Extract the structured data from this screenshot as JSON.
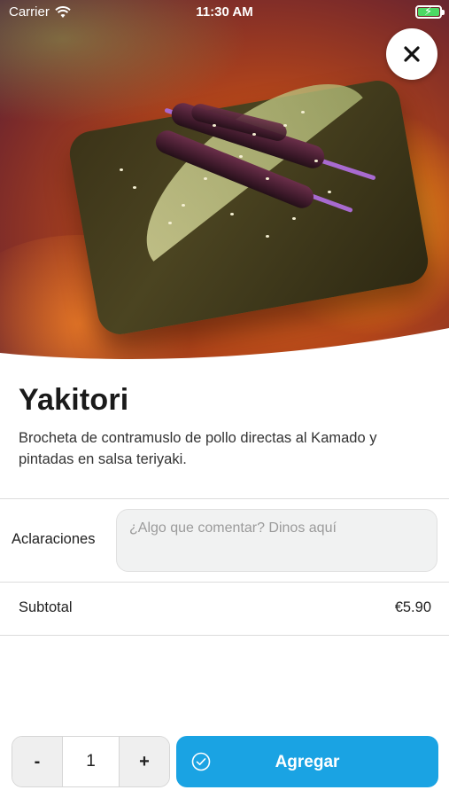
{
  "status_bar": {
    "carrier": "Carrier",
    "time": "11:30 AM",
    "battery_icon": "battery-charging-icon",
    "wifi_icon": "wifi-icon"
  },
  "hero": {
    "image_alt": "photo-of-yakitori-skewers"
  },
  "close_button": {
    "icon": "close-icon",
    "glyph": "✕"
  },
  "product": {
    "name": "Yakitori",
    "description": "Brocheta de contramuslo de pollo directas al Kamado y pintadas en salsa teriyaki."
  },
  "clarifications": {
    "label": "Aclaraciones",
    "placeholder": "¿Algo que comentar? Dinos aquí",
    "value": ""
  },
  "subtotal": {
    "label": "Subtotal",
    "value": "€5.90"
  },
  "quantity": {
    "decrement_label": "-",
    "value": "1",
    "increment_label": "+"
  },
  "add_button": {
    "label": "Agregar",
    "icon": "check-circle-icon"
  },
  "colors": {
    "accent": "#1aa3e3",
    "text": "#1a1a1a",
    "divider": "#dcdcdc"
  }
}
